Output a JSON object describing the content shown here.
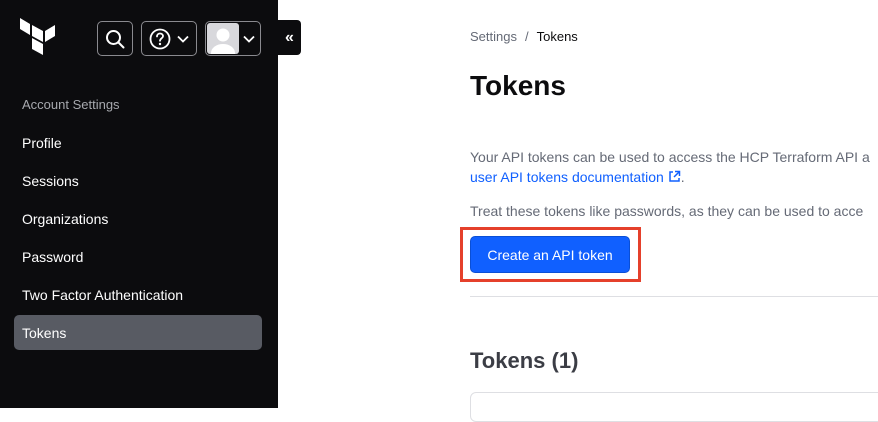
{
  "sidebar": {
    "section_label": "Account Settings",
    "items": [
      {
        "label": "Profile",
        "active": false
      },
      {
        "label": "Sessions",
        "active": false
      },
      {
        "label": "Organizations",
        "active": false
      },
      {
        "label": "Password",
        "active": false
      },
      {
        "label": "Two Factor Authentication",
        "active": false
      },
      {
        "label": "Tokens",
        "active": true
      }
    ],
    "collapse_glyph": "«"
  },
  "header": {
    "icons": [
      "terraform-logo",
      "search-icon",
      "help-icon",
      "user-avatar",
      "chevron-down-icon"
    ]
  },
  "breadcrumb": {
    "parent": "Settings",
    "separator": "/",
    "current": "Tokens"
  },
  "page": {
    "title": "Tokens",
    "para1_line1": "Your API tokens can be used to access the HCP Terraform API a",
    "para1_link": "user API tokens documentation",
    "para1_end": ".",
    "para2": "Treat these tokens like passwords, as they can be used to acce",
    "create_button": "Create an API token",
    "section_title": "Tokens (1)"
  },
  "colors": {
    "sidebar_bg": "#0c0c0e",
    "active_item": "#585b63",
    "primary": "#1060ff",
    "highlight": "#e5402b"
  }
}
